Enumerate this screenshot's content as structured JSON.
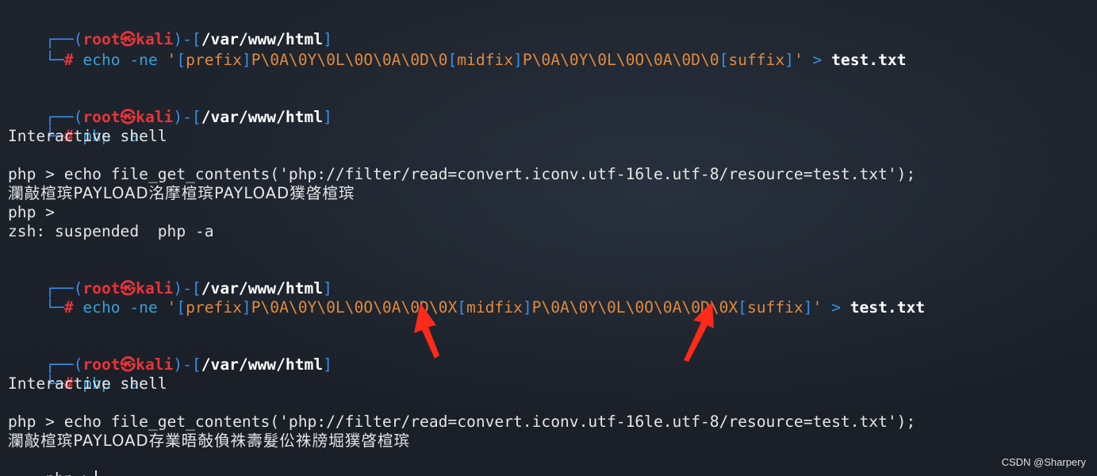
{
  "prompt": {
    "corner_top": "┌──(",
    "user": "root㉿kali",
    "mid": ")-[",
    "path": "/var/www/html",
    "close": "]",
    "corner_bottom": "└─",
    "hash": "#"
  },
  "blocks": [
    {
      "cmd": "echo",
      "flag": "-ne",
      "q1": "'",
      "b1": "[",
      "w1": "prefix",
      "b2": "]",
      "seq1": "P\\0A\\0Y\\0L\\0O\\0A\\0D\\0",
      "b3": "[",
      "w2": "midfix",
      "b4": "]",
      "seq2": "P\\0A\\0Y\\0L\\0O\\0A\\0D\\0",
      "b5": "[",
      "w3": "suffix",
      "b6": "]",
      "q2": "'",
      "redir": ">",
      "file": "test.txt"
    },
    {
      "cmd": "php",
      "flag": "-a",
      "out1": "Interactive shell",
      "php_line": "php > echo file_get_contents('php://filter/read=convert.iconv.utf-16le.utf-8/resource=test.txt');",
      "garbled": "瀾敲楦瑸PAYLOAD洺摩楦瑸PAYLOAD獛晵楦瑸",
      "php_prompt": "php >",
      "suspend": "zsh: suspended  php -a"
    },
    {
      "cmd": "echo",
      "flag": "-ne",
      "q1": "'",
      "b1": "[",
      "w1": "prefix",
      "b2": "]",
      "seq1": "P\\0A\\0Y\\0L\\0O\\0A\\0D\\0X",
      "b3": "[",
      "w2": "midfix",
      "b4": "]",
      "seq2": "P\\0A\\0Y\\0L\\0O\\0A\\0D\\0X",
      "b5": "[",
      "w3": "suffix",
      "b6": "]",
      "q2": "'",
      "redir": ">",
      "file": "test.txt"
    },
    {
      "cmd": "php",
      "flag": "-a",
      "out1": "Interactive shell",
      "php_line": "php > echo file_get_contents('php://filter/read=convert.iconv.utf-16le.utf-8/resource=test.txt');",
      "garbled": "瀾敲楦瑸PAYLOAD存業晤敧偩祩壽髮伀祩牓堀獛晵楦瑸",
      "php_prompt": "php >"
    }
  ],
  "watermark": "CSDN @Sharpery",
  "colors": {
    "background": "#1b2028",
    "prompt_blue": "#3b8eea",
    "user_red": "#e8343a",
    "string_orange": "#e28a3c",
    "arrow_red": "#ff2a1a"
  },
  "icons": [
    "annotation-arrow",
    "annotation-arrow"
  ]
}
